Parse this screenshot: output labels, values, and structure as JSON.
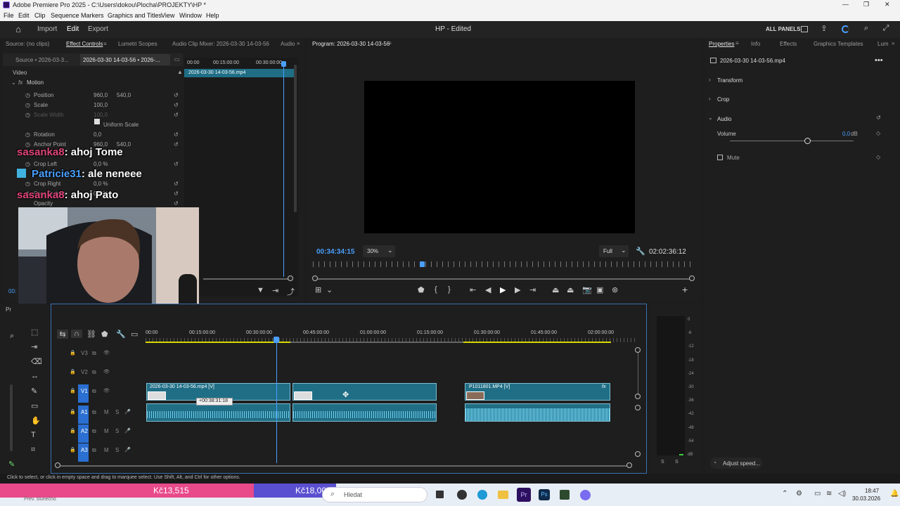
{
  "titlebar": {
    "title": "Adobe Premiere Pro 2025 - C:\\Users\\dokou\\Plocha\\PROJEKTY\\HP *",
    "controls": [
      "—",
      "❐",
      "✕"
    ]
  },
  "menu": [
    "File",
    "Edit",
    "Clip",
    "Sequence",
    "Markers",
    "Graphics and Titles",
    "View",
    "Window",
    "Help"
  ],
  "workspace": {
    "tabs": [
      "Import",
      "Edit",
      "Export"
    ],
    "active": "Edit",
    "project_title": "HP - Edited",
    "all_panels": "ALL PANELS"
  },
  "source_panel": {
    "tabs": [
      "Source: (no clips)",
      "Effect Controls",
      "Lumetri Scopes",
      "Audio Clip Mixer: 2026-03-30 14-03-56",
      "Audio"
    ],
    "sub_tabs": [
      "Source • 2026-03-3...",
      "2026-03-30 14-03-56 • 2026-..."
    ],
    "section_video": "Video",
    "motion": "Motion",
    "props": [
      {
        "name": "Position",
        "v1": "960,0",
        "v2": "540,0"
      },
      {
        "name": "Scale",
        "v1": "100,0",
        "v2": ""
      },
      {
        "name": "Scale Width",
        "v1": "100,0",
        "v2": ""
      },
      {
        "name": "Uniform Scale",
        "v1": "",
        "v2": ""
      },
      {
        "name": "Rotation",
        "v1": "0,0",
        "v2": ""
      },
      {
        "name": "Anchor Point",
        "v1": "960,0",
        "v2": "540,0"
      },
      {
        "name": "Crop Left",
        "v1": "0,0 %",
        "v2": ""
      },
      {
        "name": "Crop Right",
        "v1": "0,0 %",
        "v2": ""
      },
      {
        "name": "Crop Bottom",
        "v1": "0,0 %",
        "v2": ""
      },
      {
        "name": "Opacity",
        "v1": "",
        "v2": ""
      }
    ],
    "mini_ruler": [
      "00:00",
      "00:15:00:00",
      "00:30:00:00"
    ],
    "mini_clip": "2026-03-30 14-03-56.mp4",
    "timecode_stub": "00:"
  },
  "chat": [
    {
      "user": "sasanka8",
      "msg": ": ahoj Tome",
      "color": "#e0457b"
    },
    {
      "user": "Patricie31",
      "msg": ": ale neneee",
      "color": "#4a9fff"
    },
    {
      "user": "sasanka8",
      "msg": ": ahoj Pato",
      "color": "#e0457b"
    }
  ],
  "program": {
    "title": "Program: 2026-03-30 14-03-56",
    "timecode": "00:34:34:15",
    "zoom": "30%",
    "quality": "Full",
    "duration": "02:02:36:12",
    "playhead_fraction": 0.28
  },
  "properties": {
    "tabs": [
      "Properties",
      "Info",
      "Effects",
      "Graphics Templates",
      "Lum"
    ],
    "clip_name": "2026-03-30 14-03-56.mp4",
    "sections": [
      "Transform",
      "Crop",
      "Audio"
    ],
    "volume_label": "Volume",
    "volume_value": "0,0",
    "volume_unit": "dB",
    "mute_label": "Mute",
    "adjust_speed": "Adjust speed..."
  },
  "timeline": {
    "panel_label": "Pr",
    "ruler": [
      "00:00",
      "00:15:00:00",
      "00:30:00:00",
      "00:45:00:00",
      "01:00:00:00",
      "01:15:00:00",
      "01:30:00:00",
      "01:45:00:00",
      "02:00:00:00"
    ],
    "tracks_video": [
      "V3",
      "V2",
      "V1"
    ],
    "tracks_audio": [
      "A1",
      "A2",
      "A3"
    ],
    "mute_solo": [
      "M",
      "S"
    ],
    "clip1": "2026-03-30 14-03-56.mp4 [V]",
    "clip2": "P1011801.MP4 [V]",
    "drag_tooltip": "+00:38:31:18",
    "fx": "fx"
  },
  "meter": {
    "scale": [
      "0",
      "-6",
      "-12",
      "-18",
      "-24",
      "-30",
      "-36",
      "-42",
      "-48",
      "-54",
      "dB"
    ],
    "solo": [
      "S",
      "S"
    ]
  },
  "status": {
    "hint": "Click to select, or click in empty space and drag to marquee select. Use Shift, Alt, and Ctrl for other options."
  },
  "taskbar": {
    "price1": "Kč13,515",
    "price2": "Kč18,000",
    "weather": "Prev. slunečno",
    "search": "Hledat",
    "time": "18:47",
    "date": "30.03.2026"
  }
}
